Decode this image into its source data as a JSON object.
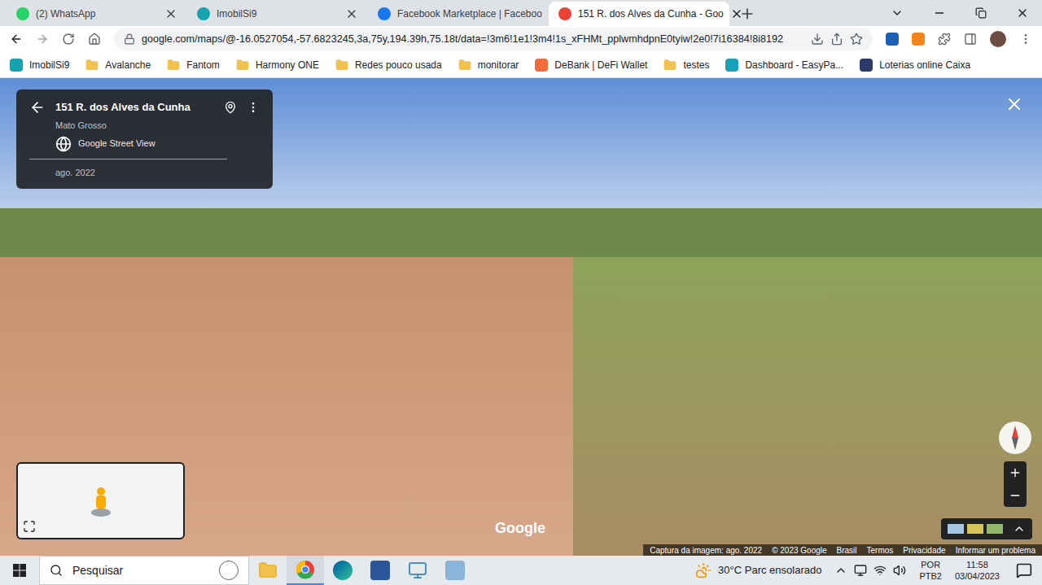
{
  "browser": {
    "tabs": [
      {
        "label": "(2) WhatsApp",
        "selected": false,
        "color": "#25d366"
      },
      {
        "label": "ImobilSi9",
        "selected": false,
        "color": "#16a3b0"
      },
      {
        "label": "Facebook Marketplace | Faceboo",
        "selected": false,
        "color": "#1877f2"
      },
      {
        "label": "151 R. dos Alves da Cunha - Goo",
        "selected": true,
        "color": "#ea4335"
      }
    ]
  },
  "address_bar": {
    "url": "google.com/maps/@-16.0527054,-57.6823245,3a,75y,194.39h,75.18t/data=!3m6!1e1!3m4!1s_xFHMt_pplwmhdpnE0tyiw!2e0!7i16384!8i8192"
  },
  "bookmarks": [
    {
      "label": "ImobilSi9",
      "kind": "site",
      "color": "#16a3b0"
    },
    {
      "label": "Avalanche",
      "kind": "folder",
      "color": "#f2c14e"
    },
    {
      "label": "Fantom",
      "kind": "folder",
      "color": "#f2c14e"
    },
    {
      "label": "Harmony ONE",
      "kind": "folder",
      "color": "#f2c14e"
    },
    {
      "label": "Redes pouco usada",
      "kind": "folder",
      "color": "#f2c14e"
    },
    {
      "label": "monitorar",
      "kind": "folder",
      "color": "#f2c14e"
    },
    {
      "label": "DeBank | DeFi Wallet",
      "kind": "site",
      "color": "#f26b3a"
    },
    {
      "label": "testes",
      "kind": "folder",
      "color": "#f2c14e"
    },
    {
      "label": "Dashboard - EasyPa...",
      "kind": "site",
      "color": "#1aa3b8"
    },
    {
      "label": "Loterias online Caixa",
      "kind": "site",
      "color": "#2b3a67"
    }
  ],
  "street_view": {
    "address": "151 R. dos Alves da Cunha",
    "region": "Mato Grosso",
    "source": "Google Street View",
    "date": "ago. 2022",
    "watermark": "Google"
  },
  "footer": [
    "Captura da imagem: ago. 2022",
    "© 2023 Google",
    "Brasil",
    "Termos",
    "Privacidade",
    "Informar um problema"
  ],
  "taskbar": {
    "search_placeholder": "Pesquisar",
    "weather": "30°C Parc ensolarado",
    "language": [
      "POR",
      "PTB2"
    ],
    "time": "11:58",
    "date": "03/04/2023"
  }
}
